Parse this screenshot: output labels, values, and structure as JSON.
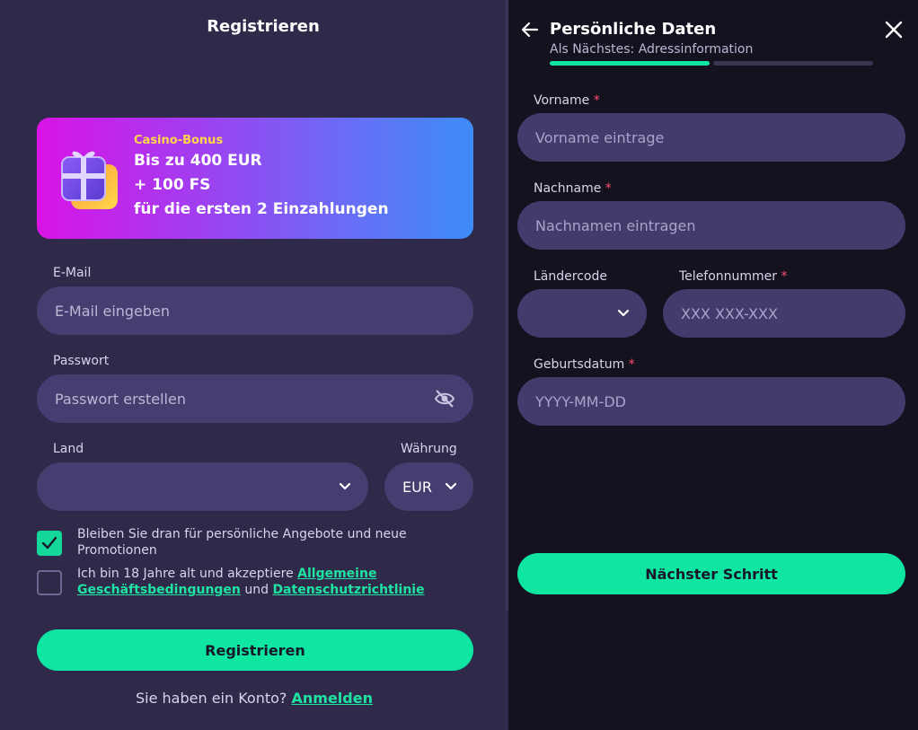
{
  "left": {
    "title": "Registrieren",
    "banner": {
      "kicker": "Casino-Bonus",
      "line1": "Bis zu 400 EUR",
      "line2": "+ 100 FS",
      "line3": "für die ersten 2 Einzahlungen",
      "icon": "gift-box-icon"
    },
    "email": {
      "label": "E-Mail",
      "placeholder": "E-Mail eingeben"
    },
    "password": {
      "label": "Passwort",
      "placeholder": "Passwort erstellen",
      "icon": "eye-slash-icon"
    },
    "country": {
      "label": "Land",
      "value": ""
    },
    "currency": {
      "label": "Währung",
      "value": "EUR"
    },
    "checkbox1": {
      "checked": true,
      "text": "Bleiben Sie dran für persönliche Angebote und neue Promotionen"
    },
    "checkbox2": {
      "checked": false,
      "text_before": "Ich bin 18 Jahre alt und akzeptiere ",
      "link1_a": "Allgemeine",
      "link1_b": "Geschäftsbedingungen",
      "text_mid": " und ",
      "link2": "Datenschutzrichtlinie"
    },
    "submit_label": "Registrieren",
    "footer": {
      "text": "Sie haben ein Konto?",
      "link": "Anmelden"
    }
  },
  "right": {
    "title": "Persönliche Daten",
    "subtitle": "Als Nächstes: Adressinformation",
    "progress_fraction": 0.5,
    "first_name": {
      "label": "Vorname",
      "placeholder": "Vorname eintrage"
    },
    "last_name": {
      "label": "Nachname",
      "placeholder": "Nachnamen eintragen"
    },
    "country_code": {
      "label": "Ländercode",
      "value": ""
    },
    "phone": {
      "label": "Telefonnummer",
      "placeholder": "XXX XXX-XXX"
    },
    "birthdate": {
      "label": "Geburtsdatum",
      "placeholder": "YYYY-MM-DD"
    },
    "required_mark": "*",
    "next_label": "Nächster Schritt"
  },
  "colors": {
    "accent": "#0ee6a2",
    "left_bg": "#2f2a4a",
    "right_bg": "#14121f",
    "input_bg": "#453e70",
    "required": "#ff4c6a"
  }
}
